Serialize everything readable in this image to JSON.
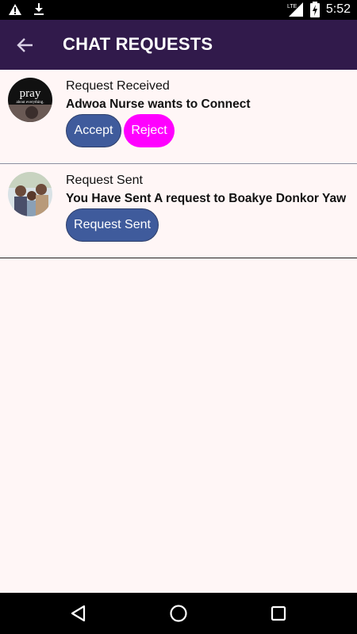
{
  "status_bar": {
    "time": "5:52",
    "network": "LTE",
    "icons": [
      "warning-icon",
      "download-icon",
      "signal-icon",
      "battery-icon"
    ]
  },
  "header": {
    "title": "CHAT REQUESTS",
    "background": "#311a4b"
  },
  "requests": [
    {
      "heading": "Request Received",
      "message": "Adwoa Nurse wants to Connect",
      "avatar_text": [
        "pray",
        "about everything."
      ],
      "buttons": {
        "accept": "Accept",
        "reject": "Reject"
      }
    },
    {
      "heading": "Request Sent",
      "message": "You Have Sent A request to Boakye Donkor Yaw",
      "button": "Request Sent"
    }
  ],
  "colors": {
    "accent_blue": "#3f5b9c",
    "reject_magenta": "#ff00ff",
    "content_background": "#fff6f6"
  },
  "nav_bar": {
    "icons": [
      "back-triangle-icon",
      "home-circle-icon",
      "recents-square-icon"
    ]
  }
}
